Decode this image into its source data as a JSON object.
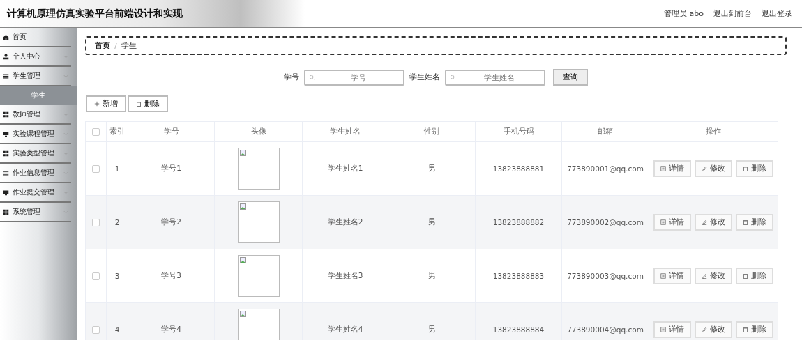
{
  "header": {
    "title": "计算机原理仿真实验平台前端设计和实现",
    "user": "管理员 abo",
    "links": [
      "退出到前台",
      "退出登录"
    ]
  },
  "sidebar": {
    "items": [
      {
        "label": "首页",
        "kind": "link"
      },
      {
        "label": "个人中心",
        "kind": "menu"
      },
      {
        "label": "学生管理",
        "kind": "menu",
        "children": [
          {
            "label": "学生",
            "selected": true
          }
        ]
      },
      {
        "label": "教师管理",
        "kind": "menu"
      },
      {
        "label": "实验课程管理",
        "kind": "menu"
      },
      {
        "label": "实验类型管理",
        "kind": "menu"
      },
      {
        "label": "作业信息管理",
        "kind": "menu"
      },
      {
        "label": "作业提交管理",
        "kind": "menu"
      },
      {
        "label": "系统管理",
        "kind": "menu"
      }
    ]
  },
  "breadcrumb": [
    "首页",
    "学生"
  ],
  "breadcrumb_separator": "/",
  "search": {
    "fields": [
      {
        "label": "学号",
        "placeholder": "学号"
      },
      {
        "label": "学生姓名",
        "placeholder": "学生姓名"
      }
    ],
    "button": "查询"
  },
  "actions": [
    "新增",
    "删除"
  ],
  "table": {
    "header_checked": false,
    "columns": [
      "索引",
      "学号",
      "头像",
      "学生姓名",
      "性别",
      "手机号码",
      "邮箱",
      "操作"
    ],
    "rows": [
      {
        "checked": false,
        "index": "1",
        "id": "学号1",
        "name": "学生姓名1",
        "gender": "男",
        "phone": "13823888881",
        "email": "773890001@qq.com",
        "ops": [
          "详情",
          "修改",
          "删除"
        ]
      },
      {
        "checked": false,
        "index": "2",
        "id": "学号2",
        "name": "学生姓名2",
        "gender": "男",
        "phone": "13823888882",
        "email": "773890002@qq.com",
        "ops": [
          "详情",
          "修改",
          "删除"
        ]
      },
      {
        "checked": false,
        "index": "3",
        "id": "学号3",
        "name": "学生姓名3",
        "gender": "男",
        "phone": "13823888883",
        "email": "773890003@qq.com",
        "ops": [
          "详情",
          "修改",
          "删除"
        ]
      },
      {
        "checked": false,
        "index": "4",
        "id": "学号4",
        "name": "学生姓名4",
        "gender": "男",
        "phone": "13823888884",
        "email": "773890004@qq.com",
        "ops": [
          "详情",
          "修改",
          "删除"
        ]
      }
    ]
  }
}
